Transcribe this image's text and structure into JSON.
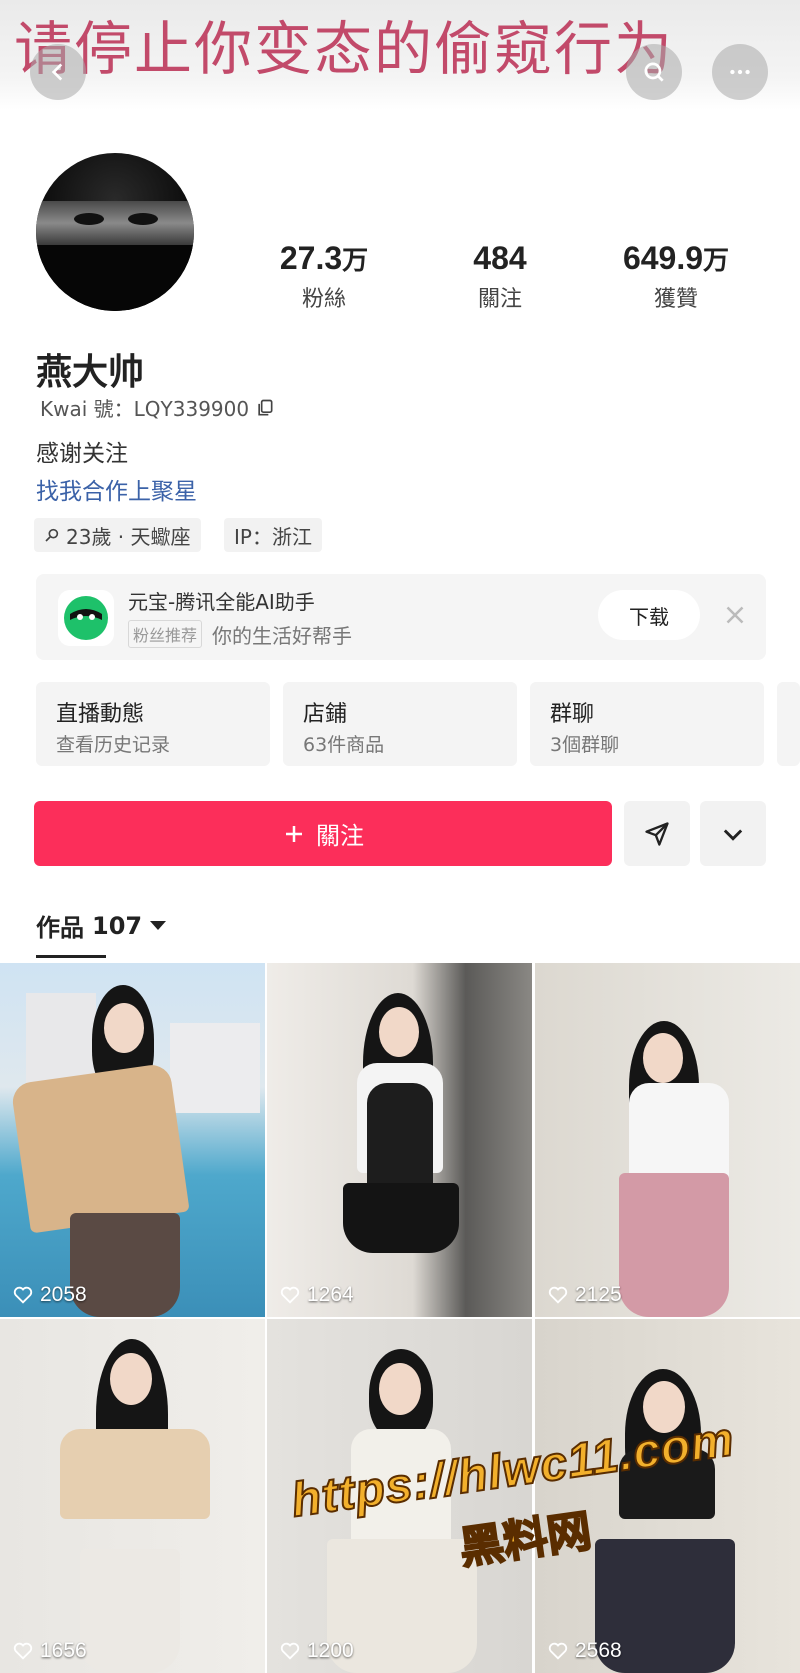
{
  "overlay": {
    "banner_text": "请停止你变态的偷窥行为"
  },
  "header": {
    "back_icon": "chevron-left-icon",
    "search_icon": "search-icon",
    "more_icon": "more-icon"
  },
  "profile": {
    "name": "燕大帅",
    "kwai_id": "Kwai 號：LQY339900",
    "bio_line1": "感谢关注",
    "bio_line2": "找我合作上聚星",
    "tags": [
      "23歲 · 天蠍座",
      "IP：浙江"
    ]
  },
  "stats": [
    {
      "number": "27.3",
      "unit": "万",
      "label": "粉絲"
    },
    {
      "number": "484",
      "unit": "",
      "label": "關注"
    },
    {
      "number": "649.9",
      "unit": "万",
      "label": "獲贊"
    }
  ],
  "ad": {
    "title": "元宝-腾讯全能AI助手",
    "badge": "粉丝推荐",
    "subtitle": "你的生活好帮手",
    "download_label": "下载",
    "accent": "#1ec16a"
  },
  "cards": [
    {
      "title": "直播動態",
      "subtitle": "查看历史记录"
    },
    {
      "title": "店鋪",
      "subtitle": "63件商品"
    },
    {
      "title": "群聊",
      "subtitle": "3個群聊"
    }
  ],
  "actions": {
    "follow_label": "關注",
    "follow_color": "#fc2e5a"
  },
  "works": {
    "label": "作品",
    "count": "107",
    "items": [
      {
        "likes": "2058"
      },
      {
        "likes": "1264"
      },
      {
        "likes": "2125"
      },
      {
        "likes": "1656"
      },
      {
        "likes": "1200"
      },
      {
        "likes": "2568"
      }
    ]
  },
  "watermark": {
    "url": "https://hlwc11.com",
    "name": "黑料网"
  }
}
